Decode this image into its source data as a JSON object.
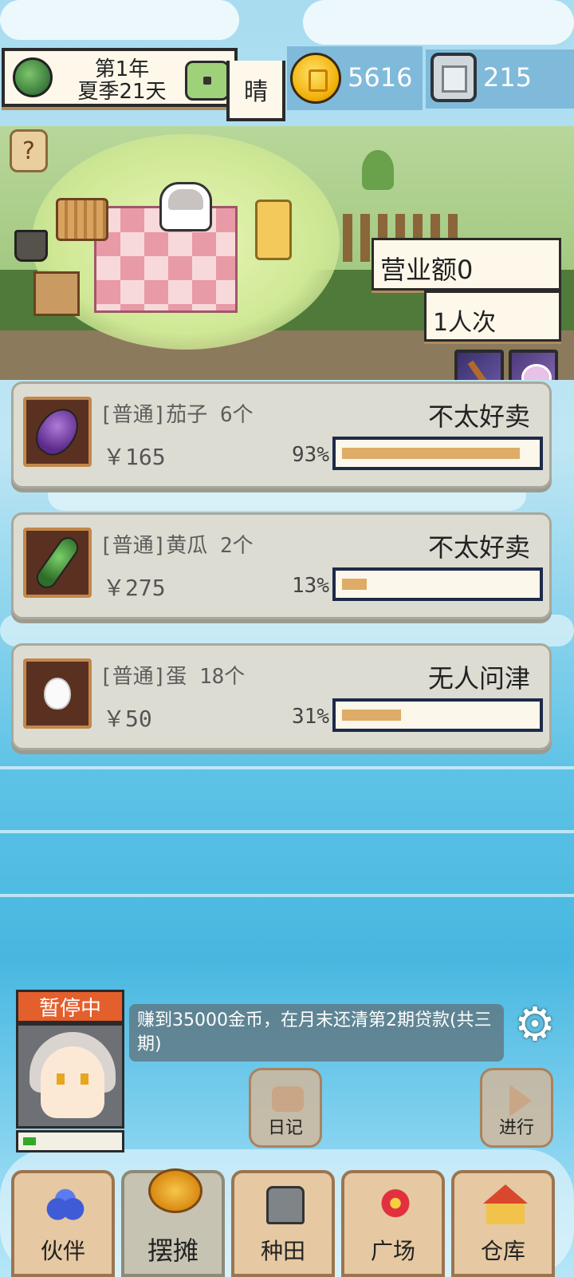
{
  "header": {
    "year": "第1年",
    "day": "夏季21天",
    "weather": "晴",
    "coins": "5616",
    "gems": "215"
  },
  "shop": {
    "revenue": "营业额0",
    "visitors": "1人次"
  },
  "items": [
    {
      "name": "[普通]茄子 6个",
      "status": "不太好卖",
      "price": "￥165",
      "progress_label": "93%",
      "progress": 0.93,
      "icon": "eggplant-icon"
    },
    {
      "name": "[普通]黄瓜 2个",
      "status": "不太好卖",
      "price": "￥275",
      "progress_label": "13%",
      "progress": 0.13,
      "icon": "cucumber-icon"
    },
    {
      "name": "[普通]蛋 18个",
      "status": "无人问津",
      "price": "￥50",
      "progress_label": "31%",
      "progress": 0.31,
      "icon": "egg-icon"
    }
  ],
  "status_tag": "暂停中",
  "character_energy": 0.14,
  "quest": "赚到35000金币，在月末还清第2期贷款(共三期)",
  "actions": {
    "diary": "日记",
    "proceed": "进行"
  },
  "nav": [
    {
      "label": "伙伴",
      "icon": "partners-icon",
      "active": false
    },
    {
      "label": "摆摊",
      "icon": "stall-icon",
      "active": true
    },
    {
      "label": "种田",
      "icon": "watering-can-icon",
      "active": false
    },
    {
      "label": "广场",
      "icon": "flower-icon",
      "active": false
    },
    {
      "label": "仓库",
      "icon": "house-icon",
      "active": false
    }
  ],
  "colors": {
    "bar_fill": "#deac66",
    "paused": "#e35f2c",
    "energy": "#31a828"
  }
}
